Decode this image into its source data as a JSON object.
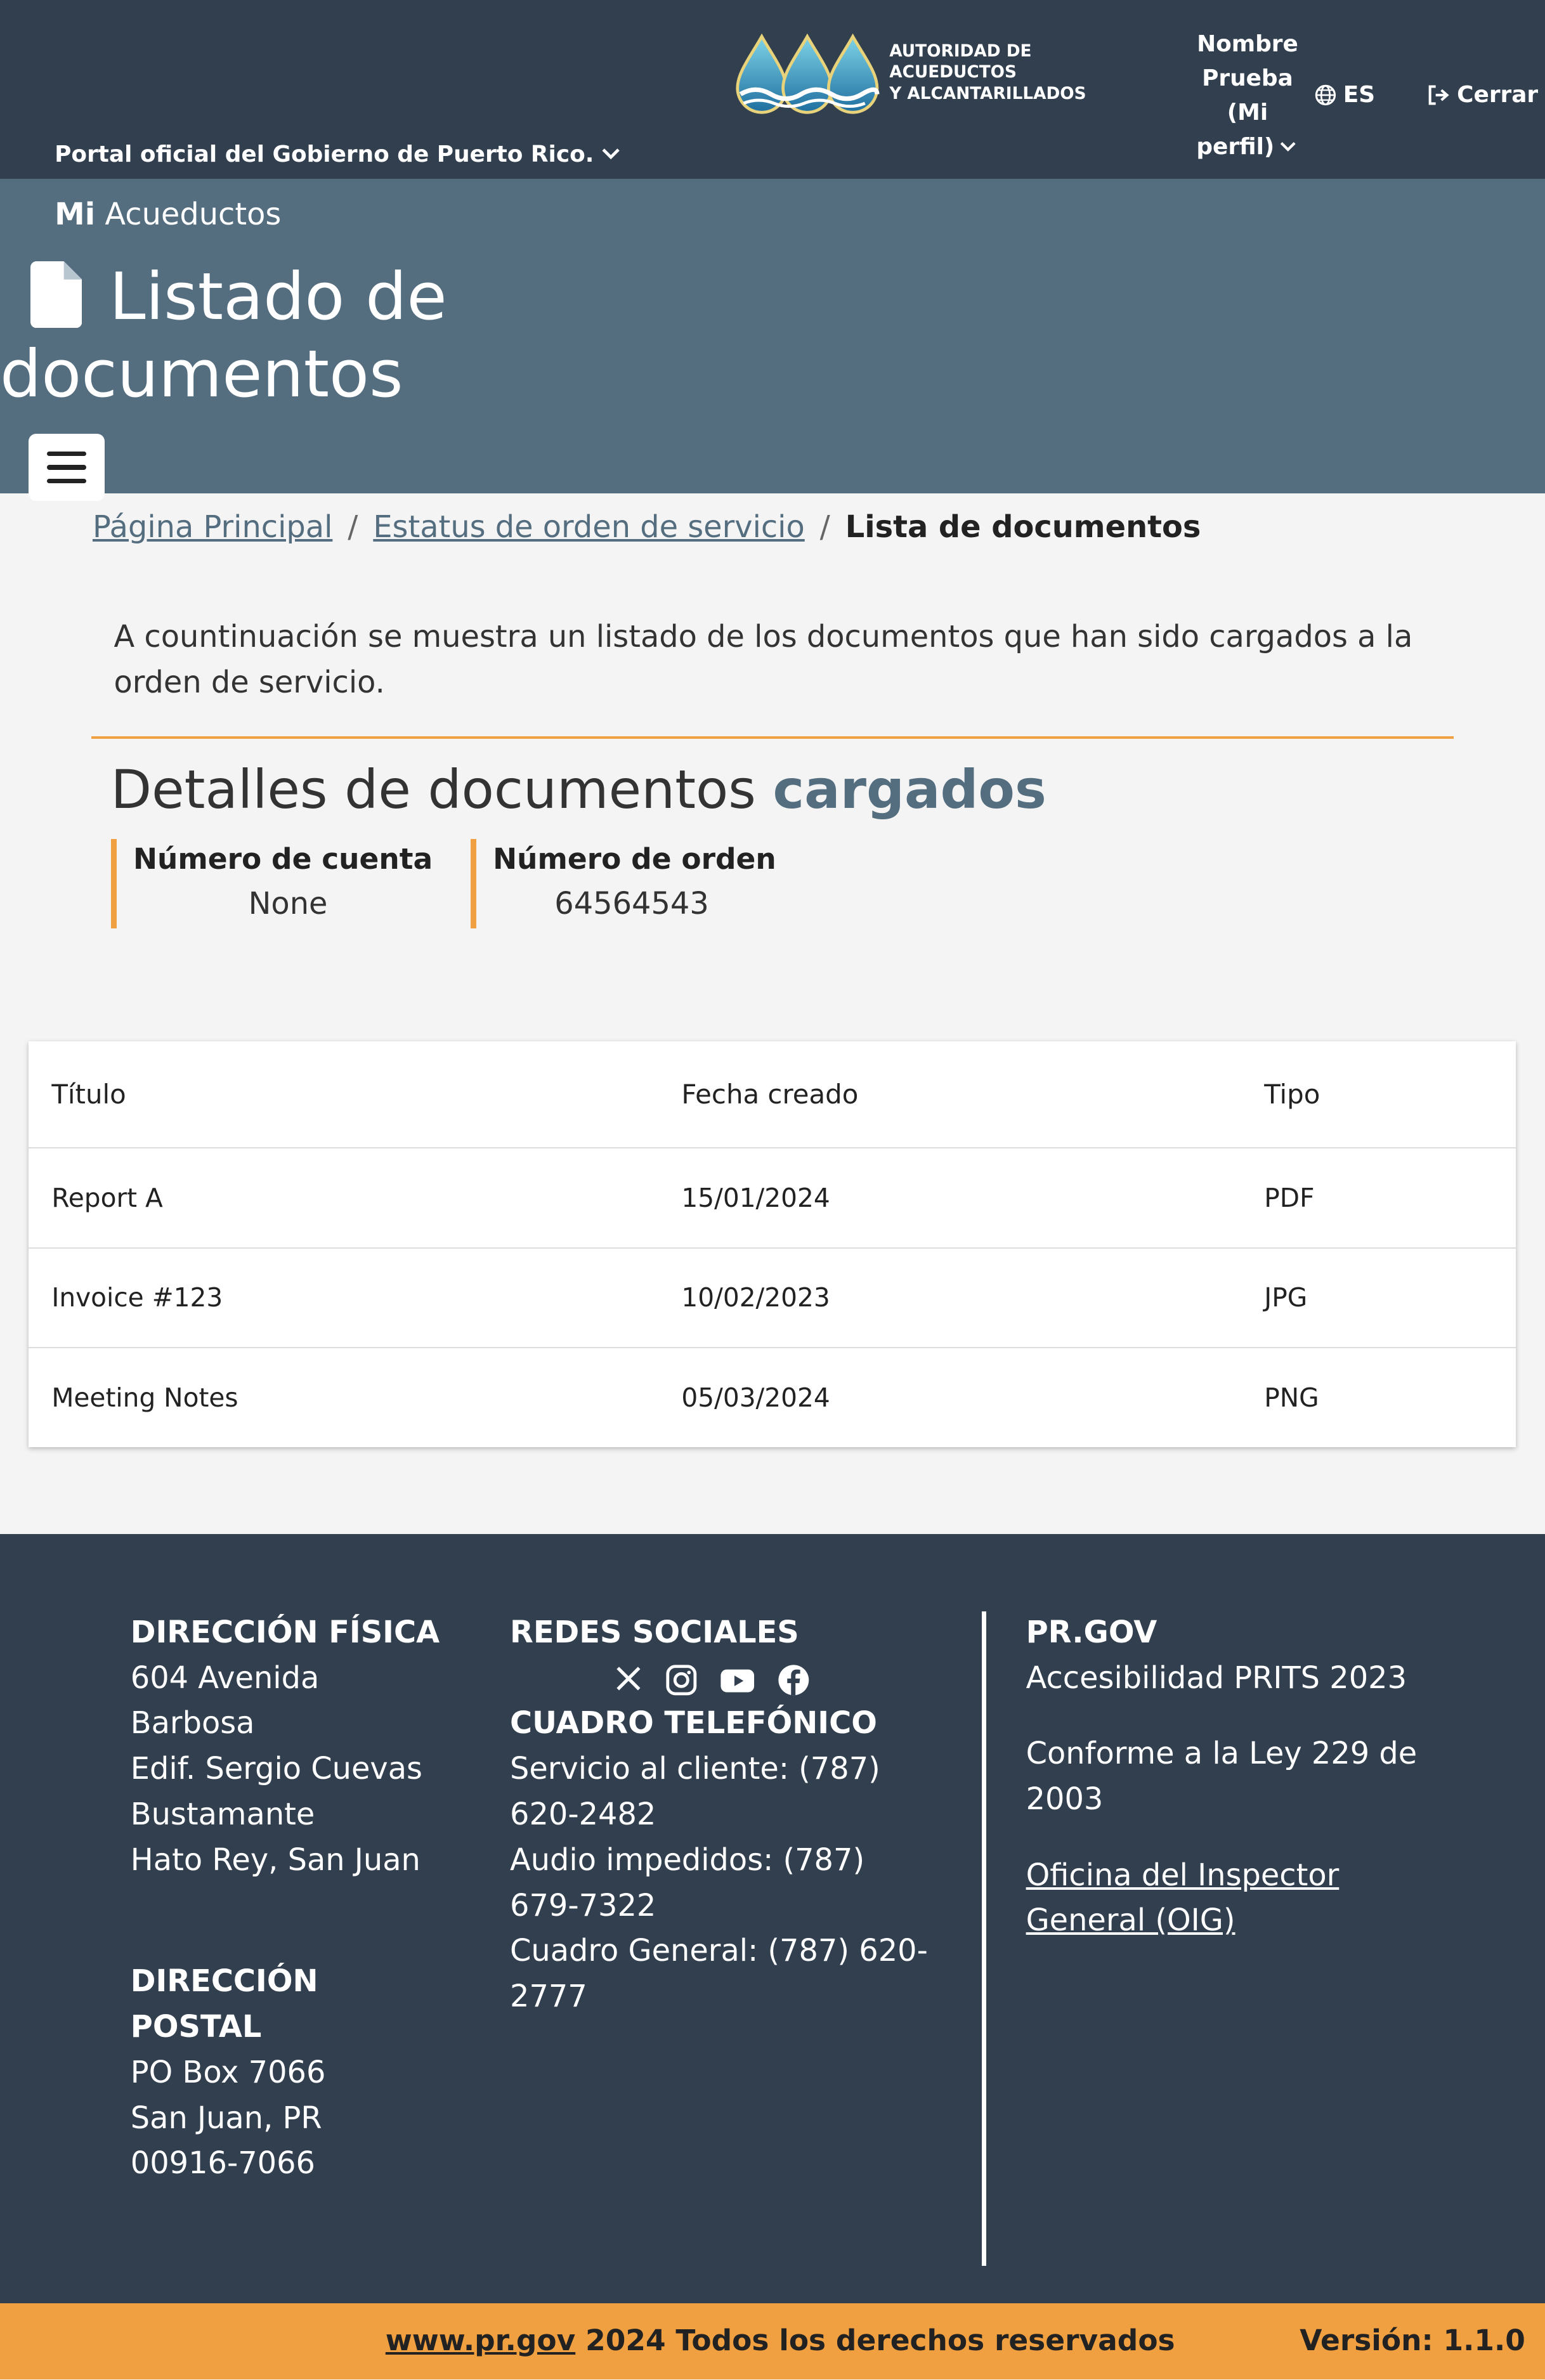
{
  "header": {
    "gov_portal": "Portal oficial del Gobierno de Puerto Rico.",
    "logo_text_line1": "AUTORIDAD DE ACUEDUCTOS",
    "logo_text_line2": "Y ALCANTARILLADOS",
    "profile_line1": "Nombre",
    "profile_line2": "Prueba",
    "profile_line3": "(Mi",
    "profile_line4": "perfil)",
    "language": "ES",
    "logout": "Cerrar"
  },
  "hero": {
    "brand_bold": "Mi",
    "brand_rest": "Acueductos",
    "title_line1": "Listado de",
    "title_line2": "documentos"
  },
  "breadcrumb": {
    "home": "Página Principal",
    "status": "Estatus de orden de servicio",
    "current": "Lista de documentos",
    "separator": "/"
  },
  "intro": "A countinuación se muestra un listado de los documentos que han sido cargados a la orden de servicio.",
  "details": {
    "title_regular": "Detalles de documentos",
    "title_bold": "cargados",
    "account_label": "Número de cuenta",
    "account_value": "None",
    "order_label": "Número de orden",
    "order_value": "64564543"
  },
  "table": {
    "headers": [
      "Título",
      "Fecha creado",
      "Tipo"
    ],
    "rows": [
      [
        "Report A",
        "15/01/2024",
        "PDF"
      ],
      [
        "Invoice #123",
        "10/02/2023",
        "JPG"
      ],
      [
        "Meeting Notes",
        "05/03/2024",
        "PNG"
      ]
    ]
  },
  "footer": {
    "physical_title": "DIRECCIÓN FÍSICA",
    "physical_lines": [
      "604 Avenida",
      "Barbosa",
      "Edif. Sergio Cuevas",
      "Bustamante",
      "Hato Rey, San Juan"
    ],
    "postal_title_1": "DIRECCIÓN",
    "postal_title_2": "POSTAL",
    "postal_lines": [
      "PO Box 7066",
      "San Juan, PR",
      "00916-7066"
    ],
    "social_title": "REDES SOCIALES",
    "social_icons": [
      "x-icon",
      "instagram-icon",
      "youtube-icon",
      "facebook-icon"
    ],
    "phone_title": "CUADRO TELEFÓNICO",
    "phone_lines": [
      "Servicio al cliente: (787)",
      "620-2482",
      "Audio impedidos: (787)",
      "679-7322",
      "Cuadro General: (787) 620-",
      "2777"
    ],
    "prgov_title": "PR.GOV",
    "prgov_access": "Accesibilidad PRITS 2023",
    "prgov_law_1": "Conforme a la Ley 229 de",
    "prgov_law_2": "2003",
    "prgov_oig_1": "Oficina del Inspector",
    "prgov_oig_2": "General (OIG)"
  },
  "bottom": {
    "site_link": "www.pr.gov",
    "rights": "2024 Todos los derechos reservados",
    "version": "Versión: 1.1.0"
  },
  "colors": {
    "header_bg": "#323f4f",
    "hero_bg": "#546e80",
    "accent": "#f0a040"
  }
}
